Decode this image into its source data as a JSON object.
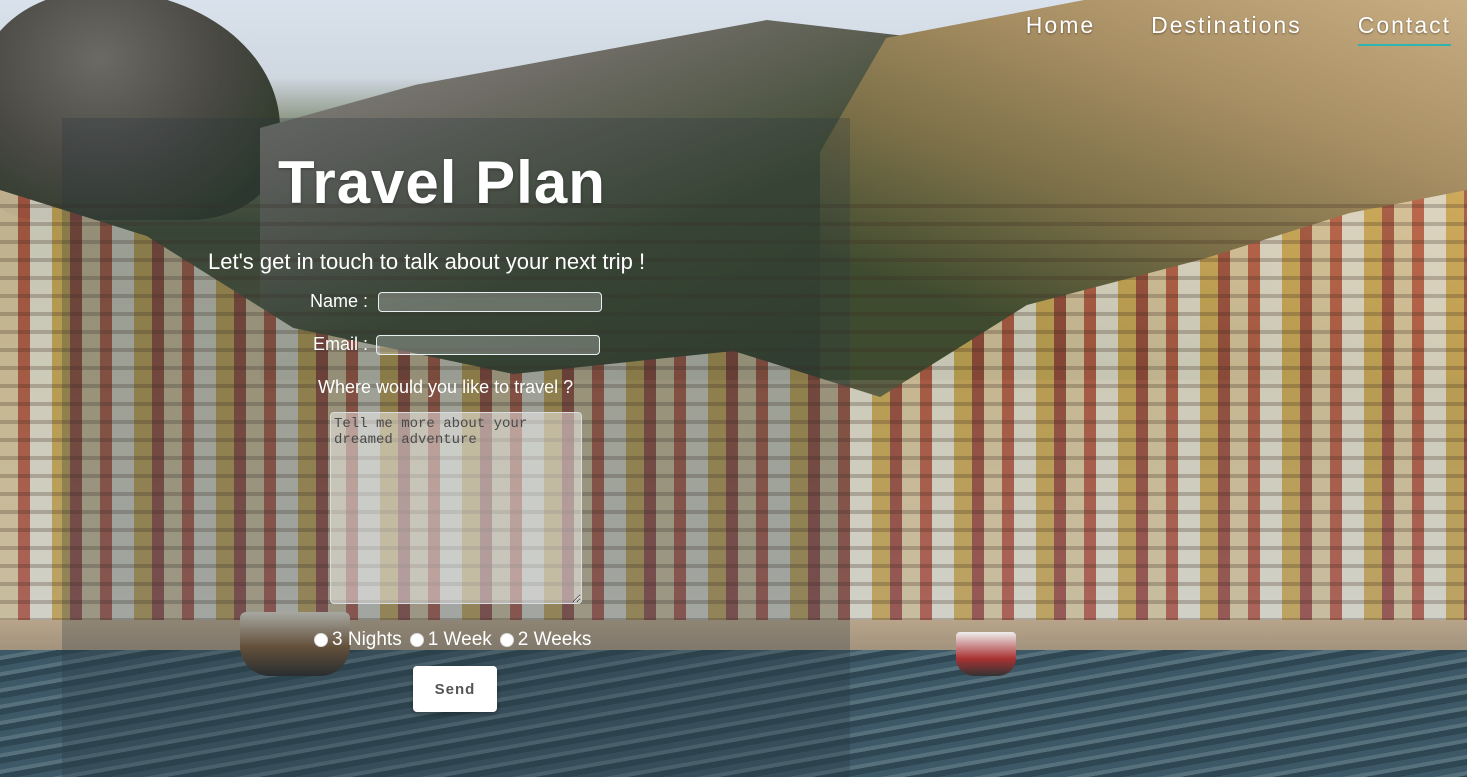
{
  "nav": {
    "items": [
      {
        "label": "Home"
      },
      {
        "label": "Destinations"
      },
      {
        "label": "Contact"
      }
    ],
    "active": "Contact",
    "active_underline_color": "#2fb3b3"
  },
  "hero": {
    "title": "Travel Plan",
    "subtitle": "Let's get in touch to talk about your next trip !"
  },
  "form": {
    "name_label": "Name :",
    "name_value": "",
    "email_label": "Email :",
    "email_value": "",
    "question": "Where would you like to travel ?",
    "message_placeholder": "Tell me more about your dreamed adventure",
    "durations": [
      {
        "label": "3 Nights",
        "selected": false
      },
      {
        "label": "1 Week",
        "selected": false
      },
      {
        "label": "2 Weeks",
        "selected": false
      }
    ],
    "send_label": "Send"
  }
}
